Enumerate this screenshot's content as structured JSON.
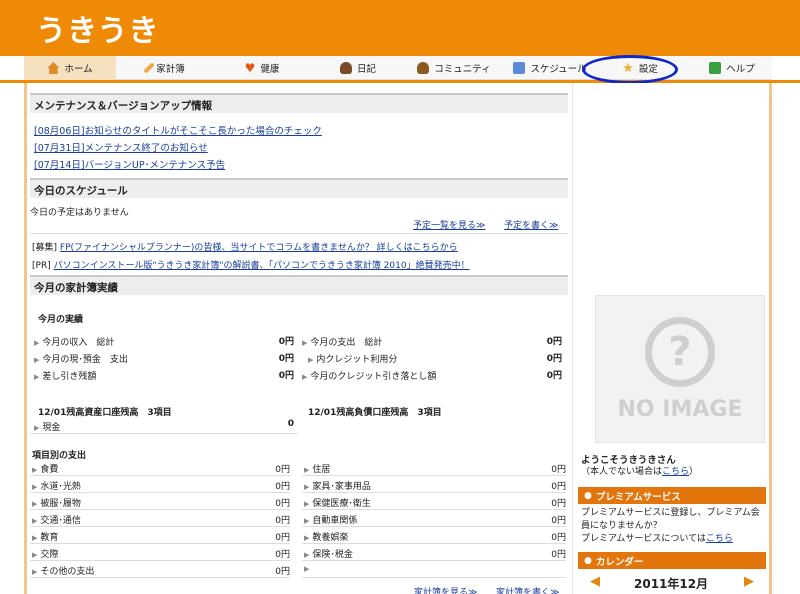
{
  "header": {
    "logo": "うきうき"
  },
  "nav": {
    "items": [
      {
        "label": "ホーム",
        "icon": "home-icon"
      },
      {
        "label": "家計簿",
        "icon": "pencil-icon"
      },
      {
        "label": "健康",
        "icon": "heart-icon"
      },
      {
        "label": "日記",
        "icon": "person-icon"
      },
      {
        "label": "コミュニティ",
        "icon": "people-icon"
      },
      {
        "label": "スケジュール",
        "icon": "calendar-icon"
      },
      {
        "label": "設定",
        "icon": "star-icon"
      },
      {
        "label": "ヘルプ",
        "icon": "help-book-icon"
      }
    ]
  },
  "maintenance": {
    "title": "メンテナンス＆バージョンアップ情報",
    "items": [
      "[08月06日]お知らせのタイトルがそこそこ長かった場合のチェック",
      "[07月31日]メンテナンス終了のお知らせ",
      "[07月14日]バージョンUP･メンテナンス予告"
    ]
  },
  "schedule": {
    "title": "今日のスケジュール",
    "empty": "今日の予定はありません",
    "list_link": "予定一覧を見る≫",
    "write_link": "予定を書く≫"
  },
  "ads": [
    {
      "prefix": "[募集]",
      "text": "FP(ファイナンシャルプランナー)の皆様、当サイトでコラムを書きませんか？ 詳しくはこちらから"
    },
    {
      "prefix": "[PR]",
      "text": "パソコンインストール版\"うきうき家計簿\"の解説書、「パソコンでうきうき家計簿 2010」絶賛発売中！"
    }
  ],
  "budget": {
    "title": "今月の家計簿実績",
    "results_title": "今月の実績",
    "left": [
      {
        "label": "今月の収入　総計",
        "value": "0円"
      },
      {
        "label": "今月の現･預金　支出",
        "value": "0円"
      },
      {
        "label": "差し引き残額",
        "value": "0円"
      }
    ],
    "right": [
      {
        "label": "今月の支出　総計",
        "value": "0円"
      },
      {
        "label": "内クレジット利用分",
        "value": "0円"
      },
      {
        "label": "今月のクレジット引き落とし額",
        "value": "0円"
      }
    ],
    "asset_title": "12/01残高資産口座残高　3項目",
    "asset_row": {
      "label": "現金",
      "value": "0"
    },
    "debt_title": "12/01残高負債口座残高　3項目",
    "category_title": "項目別の支出",
    "categories_left": [
      {
        "label": "食費",
        "value": "0円"
      },
      {
        "label": "水道･光熱",
        "value": "0円"
      },
      {
        "label": "被服･履物",
        "value": "0円"
      },
      {
        "label": "交通･通信",
        "value": "0円"
      },
      {
        "label": "教育",
        "value": "0円"
      },
      {
        "label": "交際",
        "value": "0円"
      },
      {
        "label": "その他の支出",
        "value": "0円"
      }
    ],
    "categories_right": [
      {
        "label": "住居",
        "value": "0円"
      },
      {
        "label": "家具･家事用品",
        "value": "0円"
      },
      {
        "label": "保健医療･衛生",
        "value": "0円"
      },
      {
        "label": "自動車関係",
        "value": "0円"
      },
      {
        "label": "教養娯楽",
        "value": "0円"
      },
      {
        "label": "保険･税金",
        "value": "0円"
      },
      {
        "label": "",
        "value": ""
      }
    ],
    "view_link": "家計簿を見る≫",
    "write_link": "家計簿を書く≫"
  },
  "sidebar": {
    "no_image": "NO IMAGE",
    "welcome": "ようこそうきうきさん",
    "not_you_prefix": "（本人でない場合は",
    "not_you_link": "こちら",
    "not_you_suffix": "）",
    "premium_title": "プレミアムサービス",
    "premium_text": "プレミアムサービスに登録し、プレミアム会員になりませんか？",
    "premium_more_prefix": "プレミアムサービスについては",
    "premium_more_link": "こちら",
    "calendar_title": "カレンダー",
    "calendar_month": "2011年12月"
  },
  "colors": {
    "orange": "#ef8a07",
    "highlight": "#1027c8"
  }
}
